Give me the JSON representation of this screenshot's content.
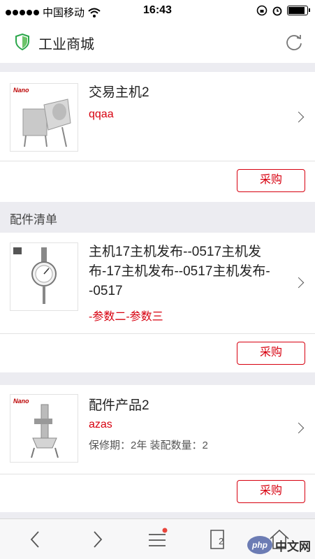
{
  "statusbar": {
    "carrier": "中国移动",
    "time": "16:43"
  },
  "navbar": {
    "title": "工业商城"
  },
  "products": [
    {
      "name": "交易主机2",
      "sub": "qqaa",
      "meta": "",
      "buy_label": "采购",
      "brand": "ano"
    },
    {
      "name": "主机17主机发布--0517主机发布-17主机发布--0517主机发布--0517",
      "sub": "-参数二-参数三",
      "meta": "",
      "buy_label": "采购",
      "brand": ""
    },
    {
      "name": "配件产品2",
      "sub": "azas",
      "meta": "保修期：2年   装配数量：2",
      "buy_label": "采购",
      "brand": "ano"
    }
  ],
  "section": {
    "title": "配件清单"
  },
  "toolbar": {
    "tabs_count": "2"
  },
  "watermark": {
    "badge": "php",
    "text": "中文网"
  },
  "colors": {
    "accent": "#d7000f",
    "background": "#ececf1"
  }
}
